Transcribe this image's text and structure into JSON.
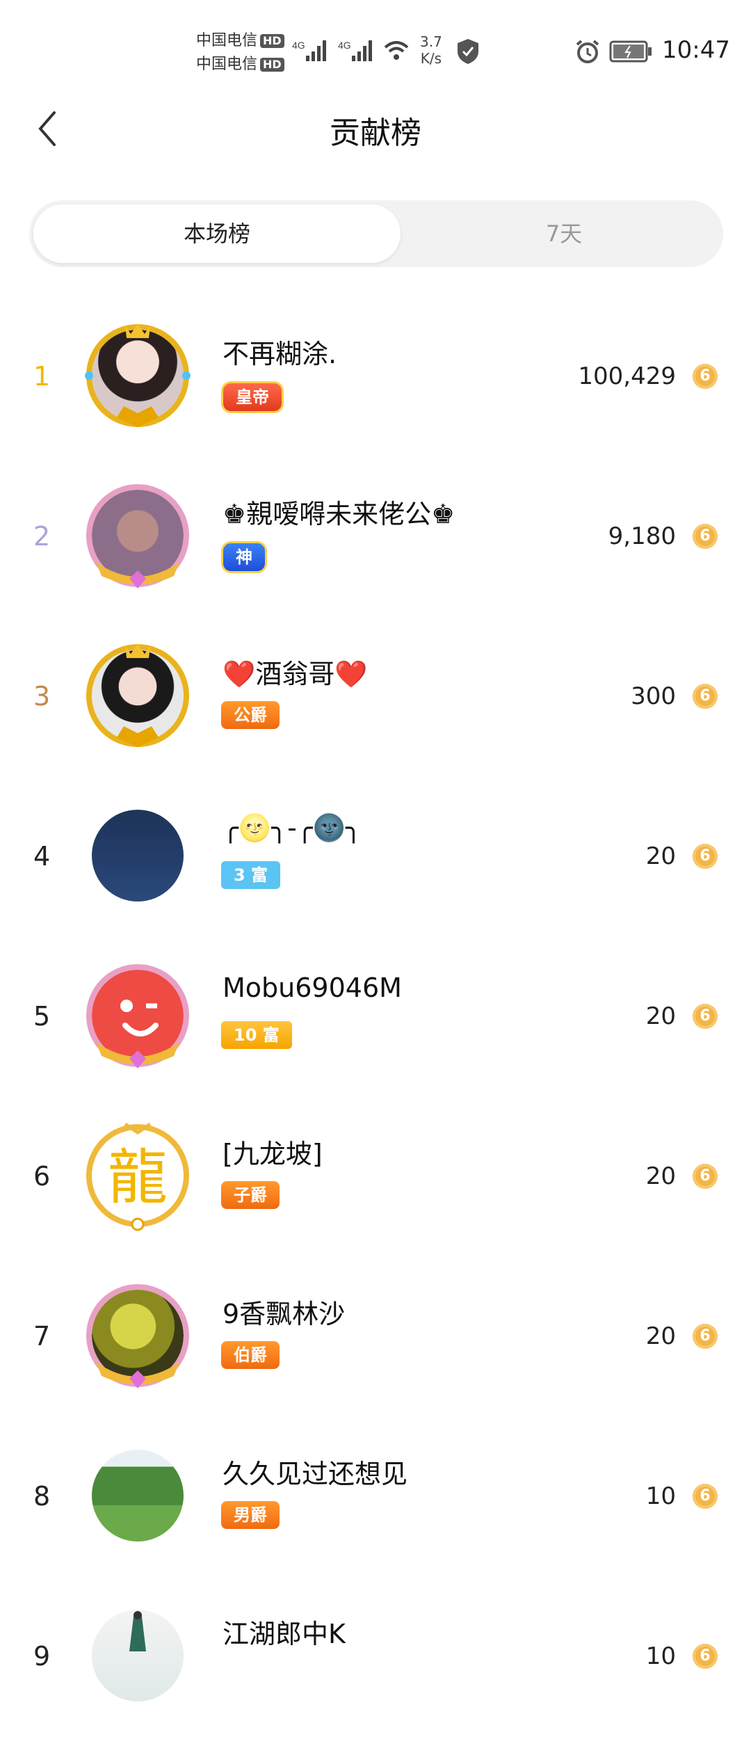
{
  "status_bar": {
    "carrier1": "中国电信",
    "carrier2": "中国电信",
    "hd_label": "HD",
    "net_4g": "4G",
    "speed_value": "3.7",
    "speed_unit": "K/s",
    "time": "10:47"
  },
  "header": {
    "title": "贡献榜"
  },
  "tabs": [
    {
      "label": "本场榜",
      "active": true
    },
    {
      "label": "7天",
      "active": false
    }
  ],
  "coin_glyph": "6",
  "ranking": [
    {
      "rank": "1",
      "name": "不再糊涂.",
      "badge": "皇帝",
      "score": "100,429"
    },
    {
      "rank": "2",
      "name": "♚親嗳嘚未来佬公♚",
      "badge": "神",
      "score": "9,180"
    },
    {
      "rank": "3",
      "name": "❤️酒翁哥❤️",
      "badge": "公爵",
      "score": "300"
    },
    {
      "rank": "4",
      "name": "╭🌝╮-╭🌚╮",
      "badge": "3 富",
      "score": "20"
    },
    {
      "rank": "5",
      "name": "Mobu69046M",
      "badge": "10 富",
      "score": "20"
    },
    {
      "rank": "6",
      "name": "[九龙坡]",
      "badge": "子爵",
      "score": "20"
    },
    {
      "rank": "7",
      "name": "9香飘林沙",
      "badge": "伯爵",
      "score": "20"
    },
    {
      "rank": "8",
      "name": "久久见过还想见",
      "badge": "男爵",
      "score": "10"
    },
    {
      "rank": "9",
      "name": "江湖郎中K",
      "badge": "",
      "score": "10"
    }
  ],
  "colors": {
    "gold_rank": "#f0b800",
    "silver_rank": "#a9a4d8",
    "bronze_rank": "#c48a4e",
    "coin": "#f4b44b"
  }
}
